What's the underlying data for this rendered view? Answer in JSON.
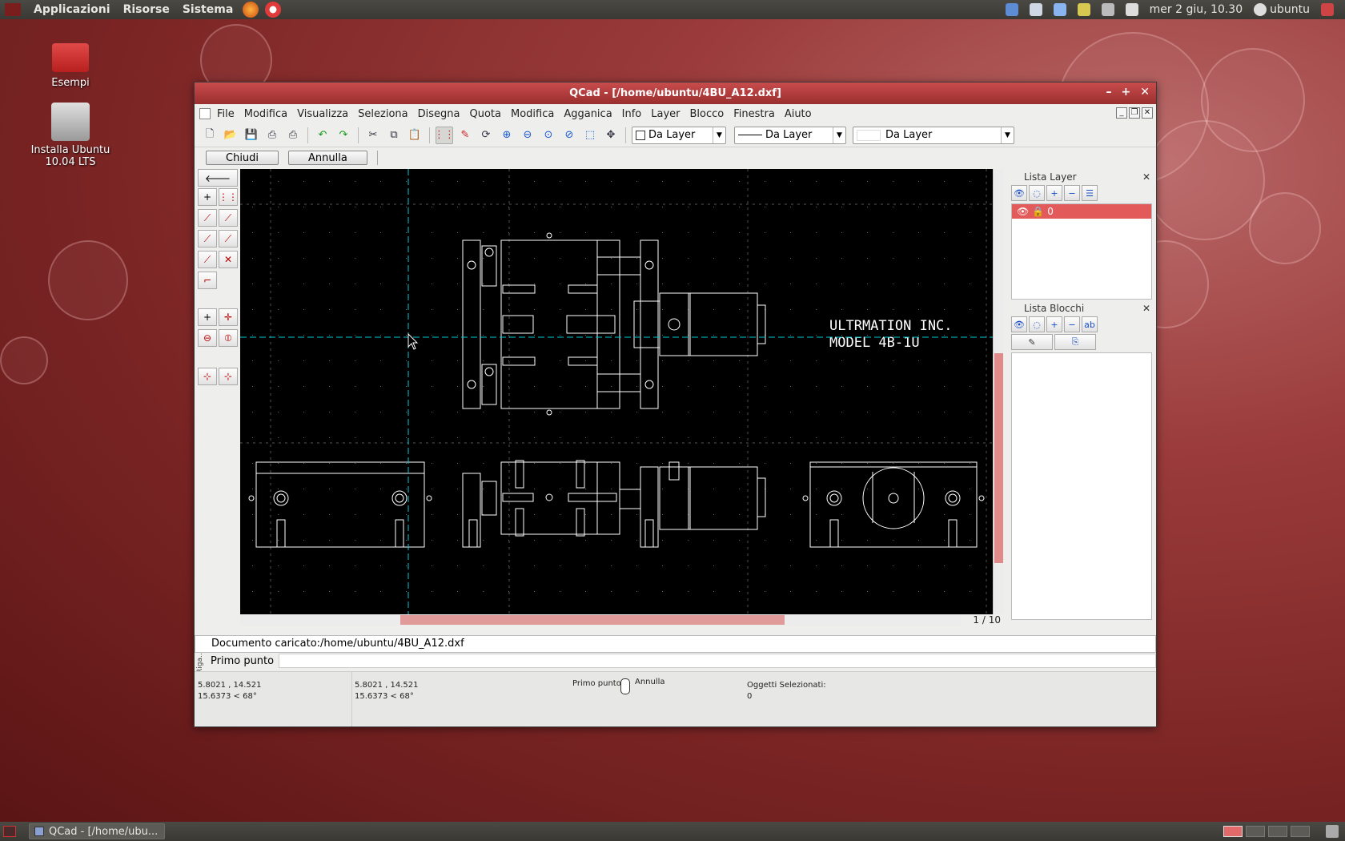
{
  "top_panel": {
    "menus": [
      "Applicazioni",
      "Risorse",
      "Sistema"
    ],
    "datetime": "mer  2 giu, 10.30",
    "user": "ubuntu"
  },
  "desktop": {
    "icons": [
      "Esempi",
      "Installa Ubuntu 10.04 LTS"
    ]
  },
  "window": {
    "title": "QCad - [/home/ubuntu/4BU_A12.dxf]",
    "menu": [
      "File",
      "Modifica",
      "Visualizza",
      "Seleziona",
      "Disegna",
      "Quota",
      "Modifica",
      "Agganica",
      "Info",
      "Layer",
      "Blocco",
      "Finestra",
      "Aiuto"
    ],
    "combos": {
      "color": "Da Layer",
      "line_width": "Da Layer",
      "line_type": "Da Layer"
    },
    "options": {
      "close": "Chiudi",
      "cancel": "Annulla"
    },
    "drawing_text": {
      "line1": "ULTRMATION INC.",
      "line2": "MODEL 4B-1U"
    },
    "page_indicator": "1 / 10",
    "docks": {
      "layer_title": "Lista Layer",
      "layer_name": "0",
      "block_title": "Lista Blocchi"
    },
    "command": {
      "history": "Documento caricato:/home/ubuntu/4BU_A12.dxf",
      "prompt": "Primo punto",
      "riga": "Riga..."
    },
    "status": {
      "abs_coord": "5.8021 , 14.521",
      "abs_polar": "15.6373 < 68°",
      "rel_coord": "5.8021 , 14.521",
      "rel_polar": "15.6373 < 68°",
      "mouse_left": "Primo punto",
      "mouse_right": "Annulla",
      "selected_label": "Oggetti Selezionati:",
      "selected_count": "0"
    }
  },
  "taskbar": {
    "task": "QCad - [/home/ubu..."
  },
  "colors": {
    "titlebar": "#b03a3a",
    "layer_selected": "#e35a5a",
    "canvas": "#000000",
    "crosshair": "#00c8d0"
  }
}
